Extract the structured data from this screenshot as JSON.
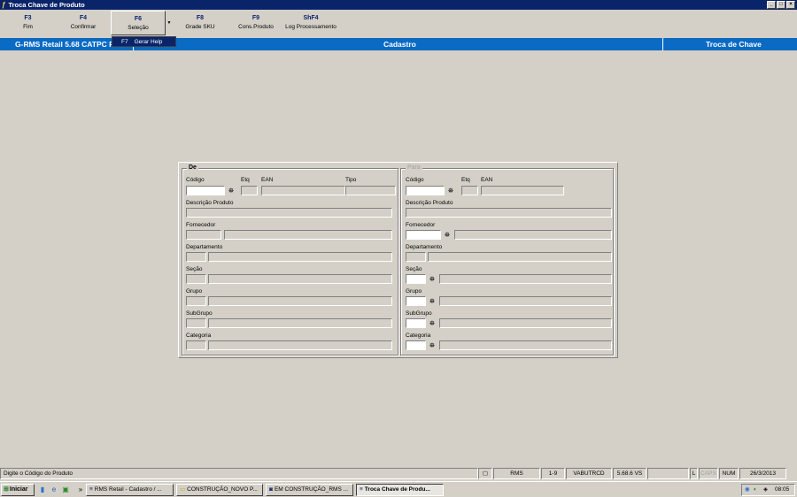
{
  "window": {
    "title": "Troca Chave de Produto",
    "controls": [
      "_",
      "□",
      "×"
    ]
  },
  "toolbar": {
    "buttons": [
      {
        "key": "F3",
        "label": "Fim"
      },
      {
        "key": "F4",
        "label": "Confirmar"
      },
      {
        "key": "F6",
        "label": "Seleção"
      },
      {
        "key": "F8",
        "label": "Grade SKU"
      },
      {
        "key": "F9",
        "label": "Cons.Produto"
      },
      {
        "key": "ShF4",
        "label": "Log Processamento"
      }
    ],
    "dropdown_item": {
      "key": "F7",
      "label": "Gerar Help"
    }
  },
  "header": {
    "system": "G-RMS Retail 5.68 CATPC R",
    "module": "Cadastro",
    "function": "Troca de Chave"
  },
  "form": {
    "de": {
      "title": "De",
      "codigo": "Código",
      "etq": "Etq",
      "ean": "EAN",
      "tipo": "Tipo",
      "descricao": "Descrição Produto",
      "fornecedor": "Fornecedor",
      "departamento": "Departamento",
      "secao": "Seção",
      "grupo": "Grupo",
      "subgrupo": "SubGrupo",
      "categoria": "Categoria"
    },
    "para": {
      "title": "Para",
      "codigo": "Código",
      "etq": "Etq",
      "ean": "EAN",
      "descricao": "Descrição Produto",
      "fornecedor": "Fornecedor",
      "departamento": "Departamento",
      "secao": "Seção",
      "grupo": "Grupo",
      "subgrupo": "SubGrupo",
      "categoria": "Categoria"
    }
  },
  "status": {
    "message": "Digite o Código do Produto",
    "user": "RMS",
    "company": "1-9",
    "program": "VABUTRCD",
    "version": "5.68.6 VS",
    "l": "L",
    "caps": "CAPS",
    "num": "NUM",
    "date": "26/3/2013"
  },
  "taskbar": {
    "start": "Iniciar",
    "more": "»",
    "tasks": [
      "RMS Retail - Cadastro / ...",
      "CONSTRUÇÃO_NOVO P...",
      "EM CONSTRUÇÃO_RMS ...",
      "Troca Chave de Produ..."
    ],
    "clock": "08:05"
  },
  "icons": {
    "app": "key-icon",
    "binoculars": "binoculars-icon",
    "start": "windows-logo-icon"
  }
}
